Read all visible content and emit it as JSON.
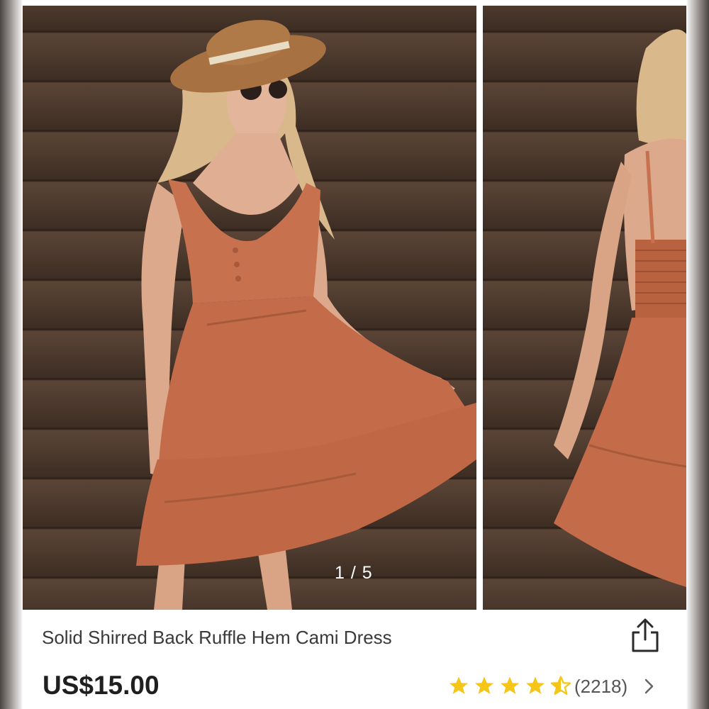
{
  "gallery": {
    "counter": "1 / 5",
    "images": [
      {
        "name": "main-photo",
        "description": "front view"
      },
      {
        "name": "side-photo",
        "description": "back view"
      }
    ]
  },
  "product": {
    "title": "Solid Shirred Back Ruffle Hem Cami Dress",
    "price": "US$15.00",
    "rating": 4.5,
    "reviews_count": "(2218)"
  },
  "icons": {
    "share": "share-icon",
    "star": "star-icon",
    "half_star": "half-star-icon",
    "chevron": "chevron-right-icon"
  },
  "colors": {
    "star": "#F5C518",
    "dress": "#C8714F",
    "wood": "#3D2D23"
  }
}
